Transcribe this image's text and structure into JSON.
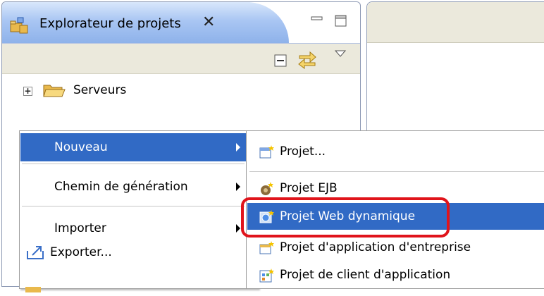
{
  "explorer": {
    "tab_title": "Explorateur de projets",
    "close_glyph": "✕",
    "tree": [
      {
        "label": "Serveurs",
        "icon": "folder-icon"
      }
    ]
  },
  "context_menu": {
    "items": [
      {
        "label": "Nouveau",
        "has_submenu": true,
        "selected": true
      },
      {
        "label": "Chemin de génération",
        "has_submenu": true
      },
      {
        "label": "Importer",
        "has_submenu": true
      },
      {
        "label": "Exporter...",
        "icon": "export-icon"
      }
    ]
  },
  "submenu": {
    "items": [
      {
        "label": "Projet...",
        "icon": "new-project-icon"
      },
      {
        "label": "Projet EJB",
        "icon": "ejb-project-icon"
      },
      {
        "label": "Projet Web dynamique",
        "icon": "web-project-icon",
        "selected": true
      },
      {
        "label": "Projet d'application d'entreprise",
        "icon": "ear-project-icon"
      },
      {
        "label": "Projet de client d'application",
        "icon": "app-client-icon"
      }
    ]
  },
  "colors": {
    "selection": "#316ac5",
    "tab_gradient": "#a9c6f3",
    "highlight": "#e0141b",
    "toolbar": "#ebe9dc"
  }
}
